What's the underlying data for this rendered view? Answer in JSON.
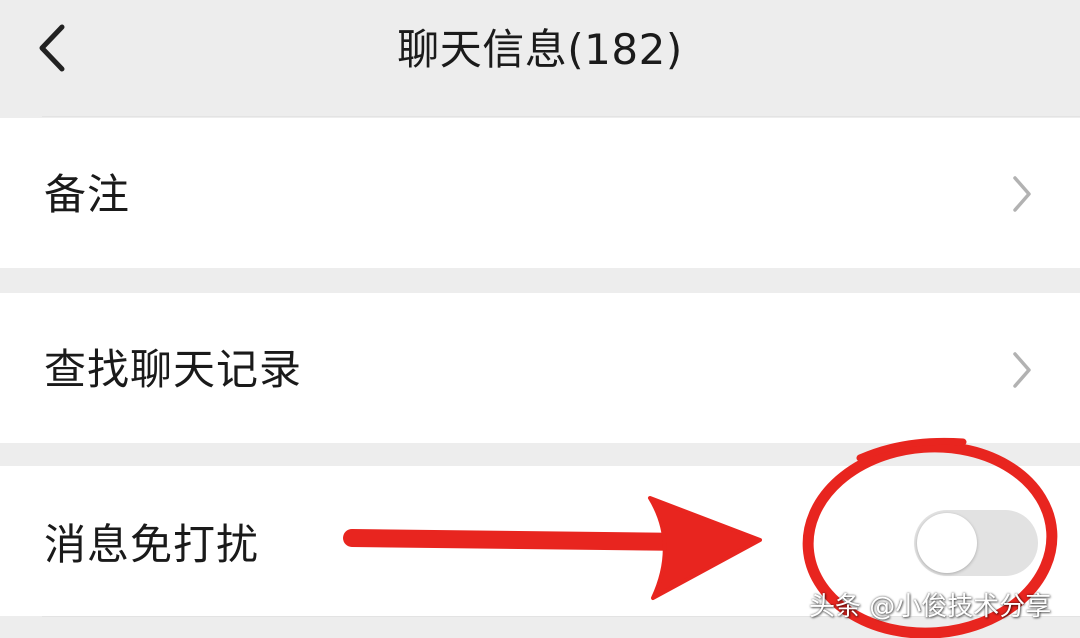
{
  "header": {
    "title": "聊天信息(182)",
    "back_icon": "chevron-left-icon"
  },
  "cells": {
    "remark_label": "备注",
    "search_label": "查找聊天记录",
    "mute_label": "消息免打扰",
    "arrow_icon": "chevron-right-icon"
  },
  "mute_toggle": {
    "checked": false,
    "track_color": "#e2e2e2",
    "knob_color": "#ffffff"
  },
  "annotation": {
    "color": "#e8251f",
    "shapes": "red arrow pointing to the toggle and red ellipse around it"
  },
  "watermark": {
    "text": "头条 @小俊技术分享"
  },
  "colors": {
    "background": "#ededed",
    "cell_background": "#ffffff",
    "text": "#1a1a1a",
    "arrow_gray": "#b2b2b2"
  }
}
